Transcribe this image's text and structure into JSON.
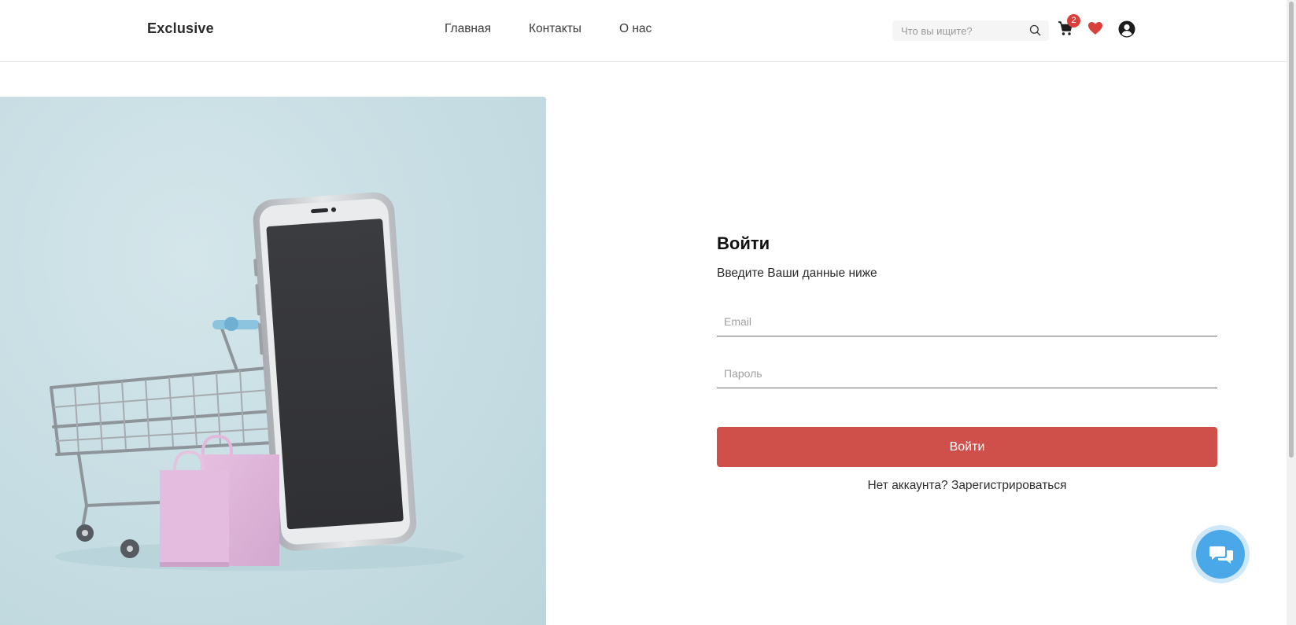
{
  "header": {
    "logo": "Exclusive",
    "nav": [
      "Главная",
      "Контакты",
      "О нас"
    ],
    "search": {
      "placeholder": "Что вы ищите?",
      "icon": "search-icon"
    },
    "cart": {
      "icon": "cart-icon",
      "count": "2"
    },
    "wishlist_icon": "heart-icon",
    "account_icon": "user-circle-icon"
  },
  "hero": {
    "image": "shopping-cart-smartphone-bags"
  },
  "login": {
    "title": "Войти",
    "subtitle": "Введите Ваши данные ниже",
    "email_placeholder": "Email",
    "password_placeholder": "Пароль",
    "submit_label": "Войти",
    "no_account_text": "Нет аккаунта?",
    "register_link": "Зарегистрироваться"
  },
  "chat": {
    "icon": "chat-bubbles-icon"
  },
  "colors": {
    "accent": "#cf504b",
    "badge": "#d9403c",
    "chat": "#4aa8e8",
    "hero_bg": "#c6dde3"
  }
}
